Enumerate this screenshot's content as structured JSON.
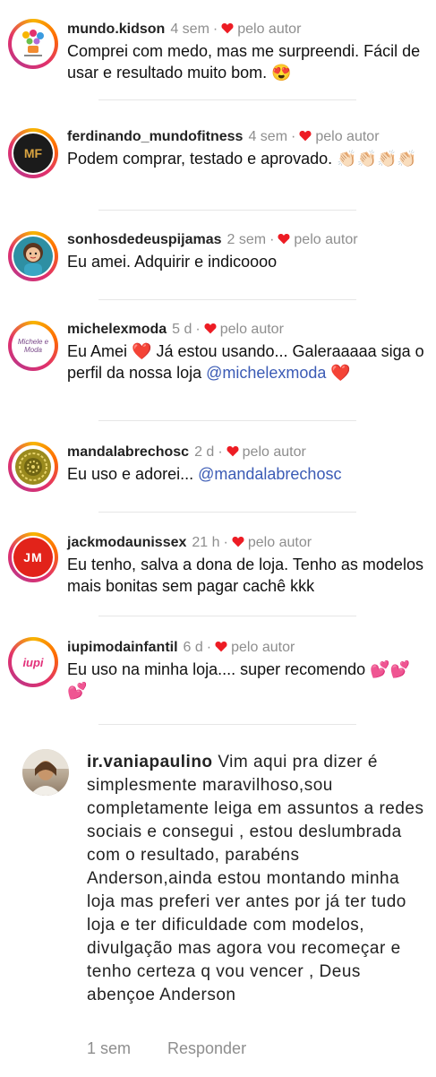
{
  "comments": [
    {
      "username": "mundo.kidson",
      "time": "4 sem",
      "badge": "pelo autor",
      "text": "Comprei com medo, mas me surpreendi. Fácil de usar e resultado muito bom. 😍"
    },
    {
      "username": "ferdinando_mundofitness",
      "time": "4 sem",
      "badge": "pelo autor",
      "text": "Podem comprar, testado e aprovado. 👏🏻👏🏻👏🏻👏🏻"
    },
    {
      "username": "sonhosdedeuspijamas",
      "time": "2 sem",
      "badge": "pelo autor",
      "text": "Eu amei. Adquirir e indicoooo"
    },
    {
      "username": "michelexmoda",
      "time": "5 d",
      "badge": "pelo autor",
      "text": "Eu Amei ❤️ Já estou usando... Galeraaaaa siga o perfil da nossa loja ",
      "mention": "@michelexmoda",
      "text_after": " ❤️"
    },
    {
      "username": "mandalabrechosc",
      "time": "2 d",
      "badge": "pelo autor",
      "text": "Eu uso e adorei... ",
      "mention": "@mandalabrechosc"
    },
    {
      "username": "jackmodaunissex",
      "time": "21 h",
      "badge": "pelo autor",
      "text": "Eu tenho, salva a dona de loja. Tenho as modelos mais bonitas sem pagar cachê kkk"
    },
    {
      "username": "iupimodainfantil",
      "time": "6 d",
      "badge": "pelo autor",
      "text": "Eu uso na minha loja.... super recomendo 💕💕💕"
    }
  ],
  "last_comment": {
    "username": "ir.vaniapaulino",
    "text": "Vim aqui pra dizer é simplesmente maravilhoso,sou completamente leiga em assuntos a redes sociais e consegui , estou deslumbrada com o resultado, parabéns Anderson,ainda estou montando minha loja mas preferi ver antes por já ter tudo loja e ter dificuldade com modelos, divulgação mas agora vou recomeçar e tenho certeza q vou vencer , Deus abençoe Anderson",
    "time": "1 sem",
    "reply_label": "Responder"
  },
  "avatars": {
    "c1": "toy",
    "c2": "MF",
    "c3": "girl",
    "c4": "Michele e Moda",
    "c5": "mandala",
    "c6": "JM",
    "c7": "iupi"
  },
  "colors": {
    "heart": "#ed1c24",
    "mention": "#3b5bb5",
    "muted": "#8e8e8e",
    "jm_bg": "#e2231a",
    "mandala": "#9a8a1e"
  }
}
